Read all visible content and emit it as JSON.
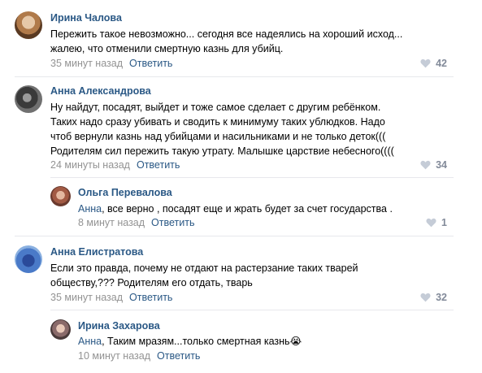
{
  "comments": [
    {
      "author": "Ирина Чалова",
      "lines": [
        "Пережить такое невозможно... сегодня все надеялись на хороший исход...",
        "жалею, что отменили смертную казнь для убийц."
      ],
      "time": "35 минут назад",
      "reply_label": "Ответить",
      "likes": "42"
    },
    {
      "author": "Анна Александрова",
      "lines": [
        "Ну найдут, посадят, выйдет и тоже самое сделает с другим ребёнком.",
        "Таких надо сразу убивать и сводить к минимуму таких ублюдков. Надо",
        "чтоб вернули казнь над убийцами и насильниками и не только деток(((",
        "Родителям сил пережить такую утрату. Малышке царствие небесного(((("
      ],
      "time": "24 минуты назад",
      "reply_label": "Ответить",
      "likes": "34"
    },
    {
      "author": "Ольга Перевалова",
      "mention": "Анна",
      "text": ", все верно , посадят еще и жрать будет за счет государства .",
      "time": "8 минут назад",
      "reply_label": "Ответить",
      "likes": "1"
    },
    {
      "author": "Анна Елистратова",
      "lines": [
        "Если это правда, почему не отдают на растерзание таких тварей",
        "обществу,??? Родителям его отдать, тварь"
      ],
      "time": "35 минут назад",
      "reply_label": "Ответить",
      "likes": "32"
    },
    {
      "author": "Ирина Захарова",
      "mention": "Анна",
      "text": ", Таким мразям...только смертная казнь😭",
      "time": "10 минут назад",
      "reply_label": "Ответить"
    }
  ],
  "colors": {
    "link": "#2a5885",
    "meta": "#939393",
    "likes": "#828a99",
    "divider": "#e7e8ec"
  }
}
